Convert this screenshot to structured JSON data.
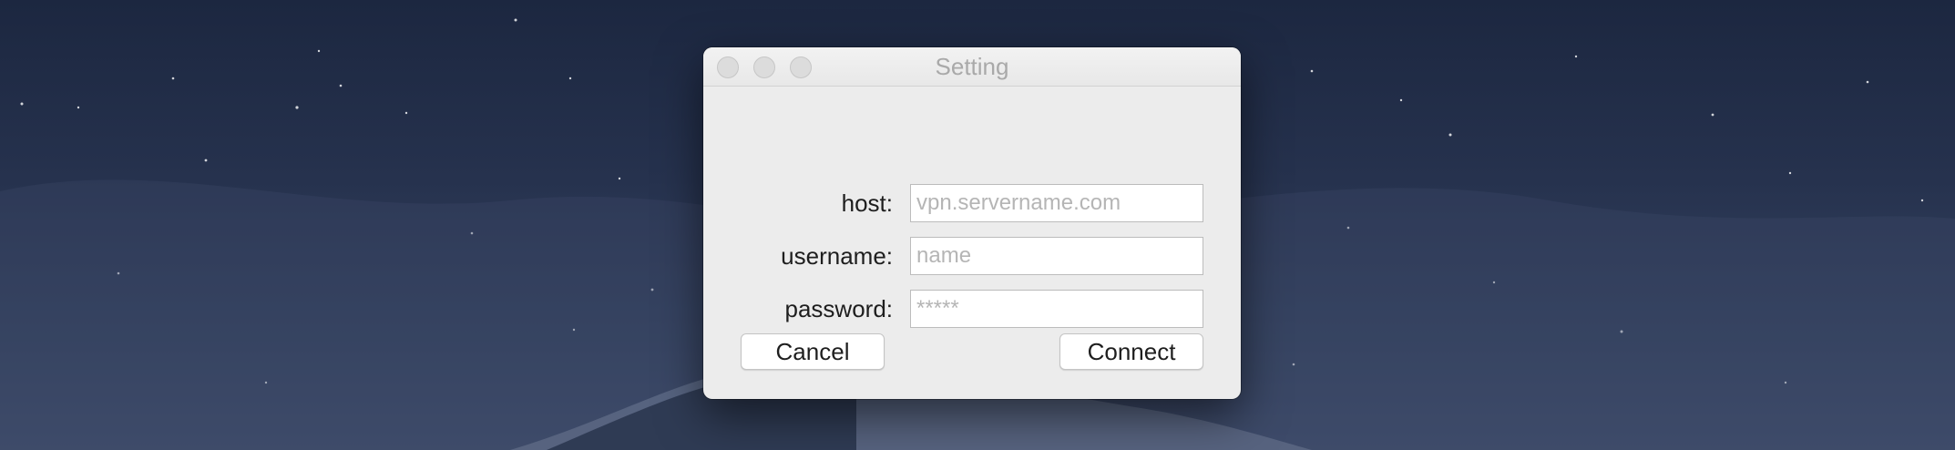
{
  "window": {
    "title": "Setting"
  },
  "form": {
    "host": {
      "label": "host:",
      "value": "",
      "placeholder": "vpn.servername.com"
    },
    "username": {
      "label": "username:",
      "value": "",
      "placeholder": "name"
    },
    "password": {
      "label": "password:",
      "value": "",
      "placeholder": "*****"
    }
  },
  "buttons": {
    "cancel_label": "Cancel",
    "connect_label": "Connect"
  },
  "colors": {
    "window_bg": "#ececec",
    "desktop_bg": "#26324e"
  }
}
